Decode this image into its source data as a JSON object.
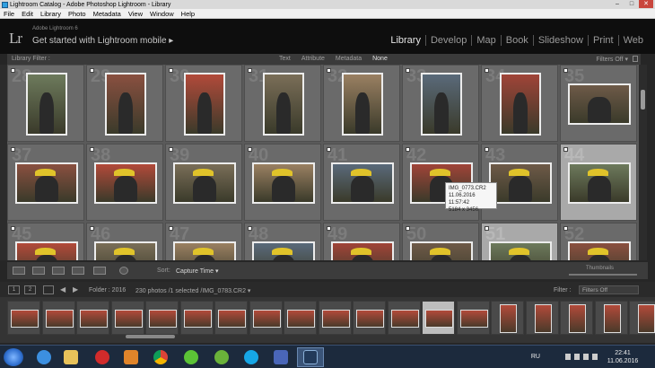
{
  "window": {
    "title": "Lightroom Catalog - Adobe Photoshop Lightroom - Library",
    "minimize": "–",
    "maximize": "□",
    "close": "✕"
  },
  "menu": [
    "File",
    "Edit",
    "Library",
    "Photo",
    "Metadata",
    "View",
    "Window",
    "Help"
  ],
  "header": {
    "logo": "Lr",
    "product": "Adobe Lightroom 6",
    "mobile": "Get started with Lightroom mobile ▸",
    "modules": [
      "Library",
      "Develop",
      "Map",
      "Book",
      "Slideshow",
      "Print",
      "Web"
    ]
  },
  "filter_bar": {
    "label": "Library Filter :",
    "options": [
      "Text",
      "Attribute",
      "Metadata",
      "None"
    ],
    "selected": "None",
    "filters_off": "Filters Off ▾"
  },
  "grid": {
    "row1": [
      {
        "num": "28",
        "o": "v"
      },
      {
        "num": "29",
        "o": "v"
      },
      {
        "num": "30",
        "o": "v"
      },
      {
        "num": "31",
        "o": "v"
      },
      {
        "num": "32",
        "o": "v"
      },
      {
        "num": "33",
        "o": "v"
      },
      {
        "num": "34",
        "o": "v"
      },
      {
        "num": "35",
        "o": "h"
      }
    ],
    "row2": [
      {
        "num": "37",
        "o": "h"
      },
      {
        "num": "38",
        "o": "h"
      },
      {
        "num": "39",
        "o": "h"
      },
      {
        "num": "40",
        "o": "h"
      },
      {
        "num": "41",
        "o": "h"
      },
      {
        "num": "42",
        "o": "h"
      },
      {
        "num": "43",
        "o": "h"
      },
      {
        "num": "44",
        "o": "h"
      }
    ],
    "row3": [
      {
        "num": "45",
        "o": "h"
      },
      {
        "num": "46",
        "o": "h"
      },
      {
        "num": "47",
        "o": "h"
      },
      {
        "num": "48",
        "o": "h"
      },
      {
        "num": "49",
        "o": "h"
      },
      {
        "num": "50",
        "o": "h"
      },
      {
        "num": "51",
        "o": "h"
      },
      {
        "num": "52",
        "o": "h"
      }
    ]
  },
  "tooltip": {
    "file": "IMG_0773.CR2",
    "date": "11.06.2016 11:57:42",
    "dims": "5184 x 3456"
  },
  "toolbar": {
    "sort_label": "Sort:",
    "sort_value": "Capture Time ▾",
    "thumbnails": "Thumbnails"
  },
  "filmstrip_header": {
    "page1": "1",
    "page2": "2",
    "folder": "Folder : 2016",
    "count": "230 photos /1 selected /IMG_0783.CR2 ▾",
    "filter_label": "Filter :",
    "filter_value": "Filters Off"
  },
  "taskbar": {
    "lang": "RU",
    "time": "22:41",
    "date": "11.06.2016"
  }
}
